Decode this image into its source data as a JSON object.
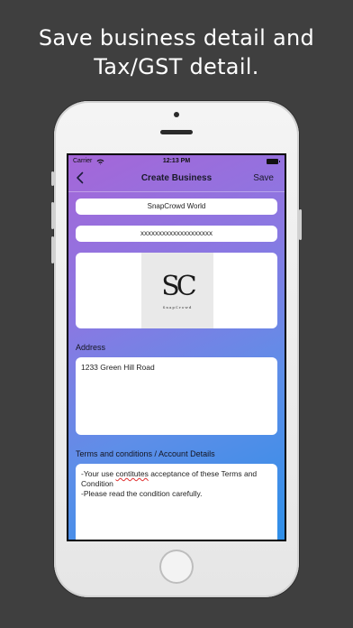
{
  "headline": {
    "line1": "Save business detail and",
    "line2": "Tax/GST detail."
  },
  "status_bar": {
    "carrier": "Carrier",
    "time": "12:13 PM"
  },
  "nav": {
    "title": "Create Business",
    "save_label": "Save",
    "back_icon": "chevron-left-icon"
  },
  "form": {
    "business_name": "SnapCrowd World",
    "tax_gst_number": "xxxxxxxxxxxxxxxxxxxx",
    "logo": {
      "mark": "SC",
      "subtitle": "SnapCrowd"
    },
    "address_label": "Address",
    "address_value": "1233 Green Hill Road",
    "terms_label": "Terms and conditions / Account Details",
    "terms_line1_prefix": "-Your use ",
    "terms_line1_misspelled": "contitutes",
    "terms_line1_suffix": " acceptance of these Terms and Condition",
    "terms_line2": "-Please read the condition carefully."
  },
  "colors": {
    "background": "#3f3f3f",
    "gradient_start": "#a566d8",
    "gradient_end": "#2f8fe8"
  }
}
